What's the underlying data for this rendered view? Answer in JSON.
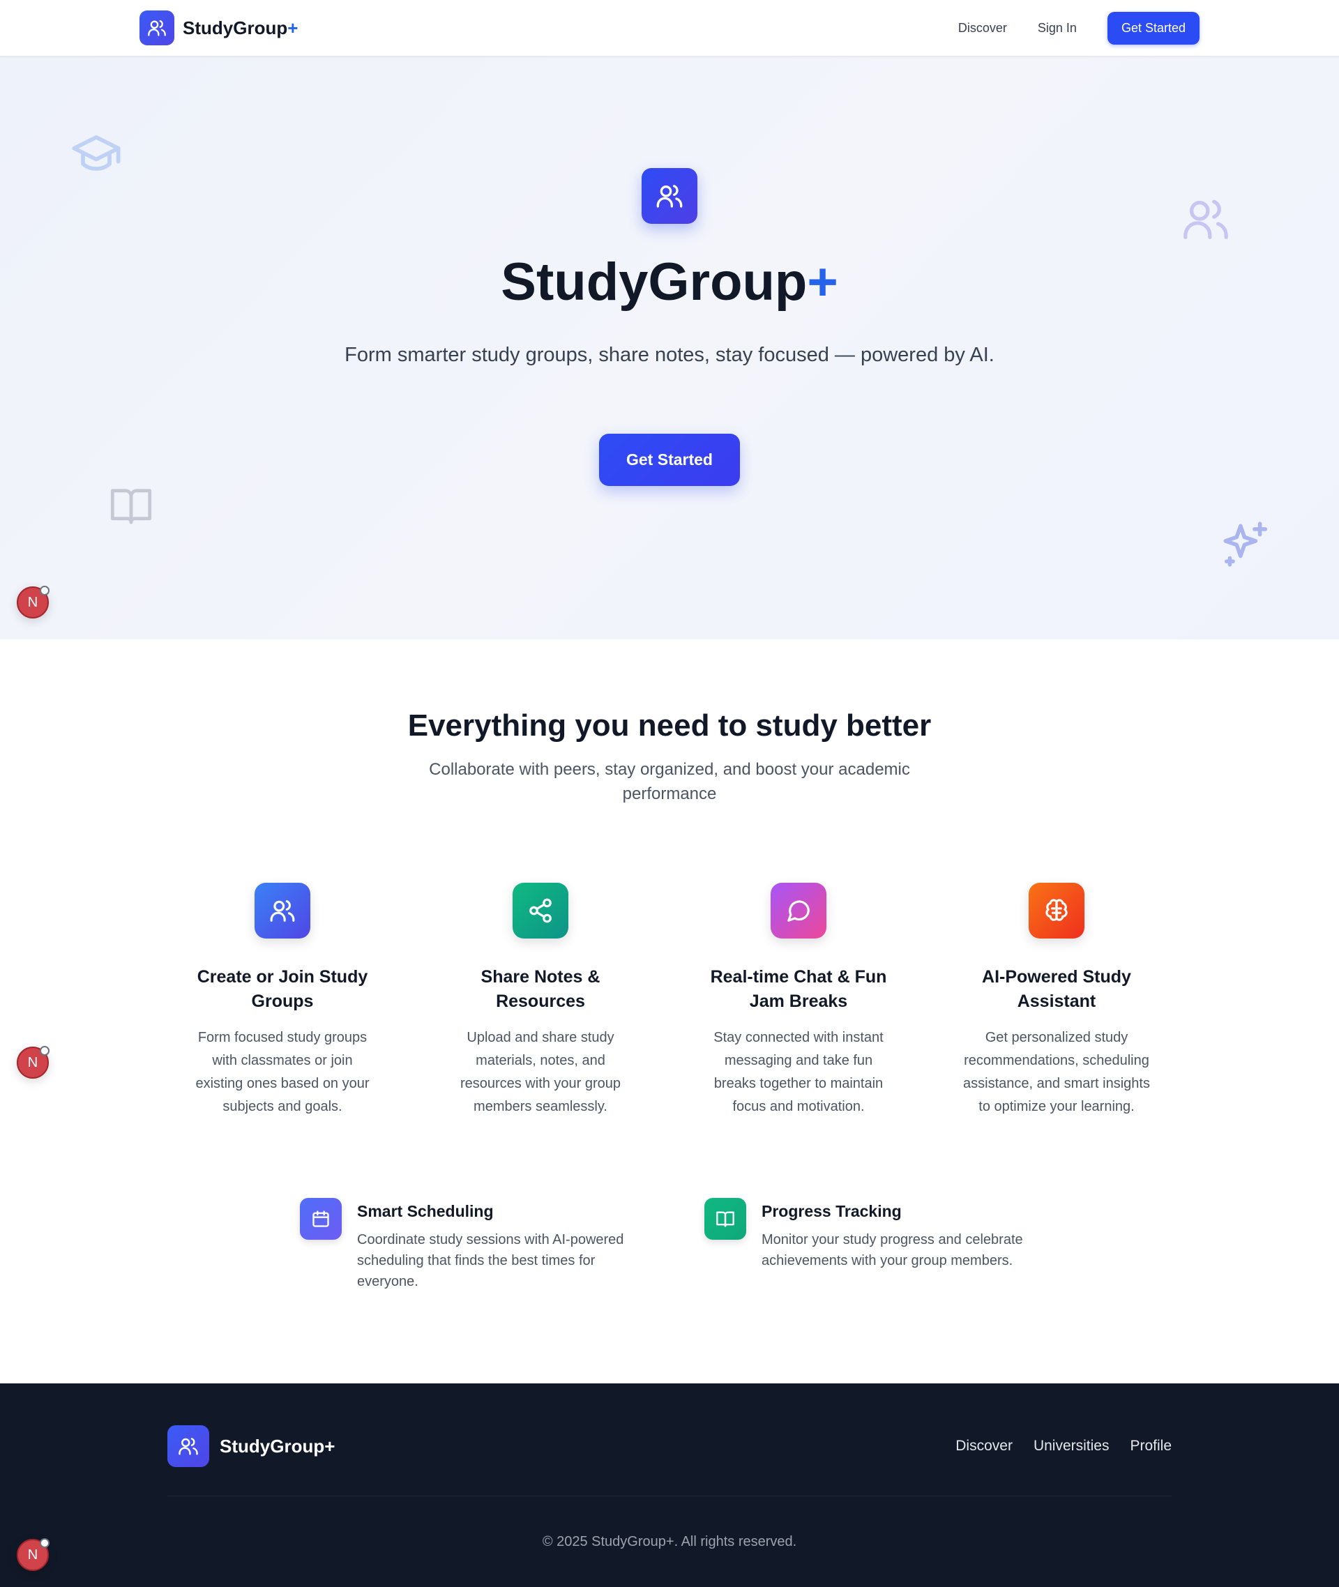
{
  "nav": {
    "brand": "StudyGroup",
    "brand_plus": "+",
    "links": [
      "Discover",
      "Sign In"
    ],
    "cta": "Get Started"
  },
  "hero": {
    "title": "StudyGroup",
    "title_plus": "+",
    "subtitle": "Form smarter study groups, share notes, stay focused — powered by AI.",
    "cta": "Get Started",
    "decorations": [
      "graduation-cap-icon",
      "users-icon",
      "book-open-icon",
      "sparkles-icon"
    ]
  },
  "floating_badge": {
    "letter": "N"
  },
  "features_section": {
    "title": "Everything you need to study better",
    "subtitle": "Collaborate with peers, stay organized, and boost your academic performance",
    "features": [
      {
        "icon": "users-icon",
        "color": "#3b6ff6",
        "title": "Create or Join Study Groups",
        "description": "Form focused study groups with classmates or join existing ones based on your subjects and goals."
      },
      {
        "icon": "share-icon",
        "color": "#10b981",
        "title": "Share Notes & Resources",
        "description": "Upload and share study materials, notes, and resources with your group members seamlessly."
      },
      {
        "icon": "message-circle-icon",
        "color": "#c042e8",
        "title": "Real-time Chat & Fun Jam Breaks",
        "description": "Stay connected with instant messaging and take fun breaks together to maintain focus and motivation."
      },
      {
        "icon": "brain-icon",
        "color": "#f4511e",
        "title": "AI-Powered Study Assistant",
        "description": "Get personalized study recommendations, scheduling assistance, and smart insights to optimize your learning."
      }
    ],
    "extras": [
      {
        "icon": "calendar-icon",
        "color": "#4f6ef7",
        "title": "Smart Scheduling",
        "description": "Coordinate study sessions with AI-powered scheduling that finds the best times for everyone."
      },
      {
        "icon": "book-open-icon",
        "color": "#10b981",
        "title": "Progress Tracking",
        "description": "Monitor your study progress and celebrate achievements with your group members."
      }
    ]
  },
  "footer": {
    "brand": "StudyGroup+",
    "links": [
      "Discover",
      "Universities",
      "Profile"
    ],
    "copyright": "© 2025 StudyGroup+. All rights reserved."
  }
}
